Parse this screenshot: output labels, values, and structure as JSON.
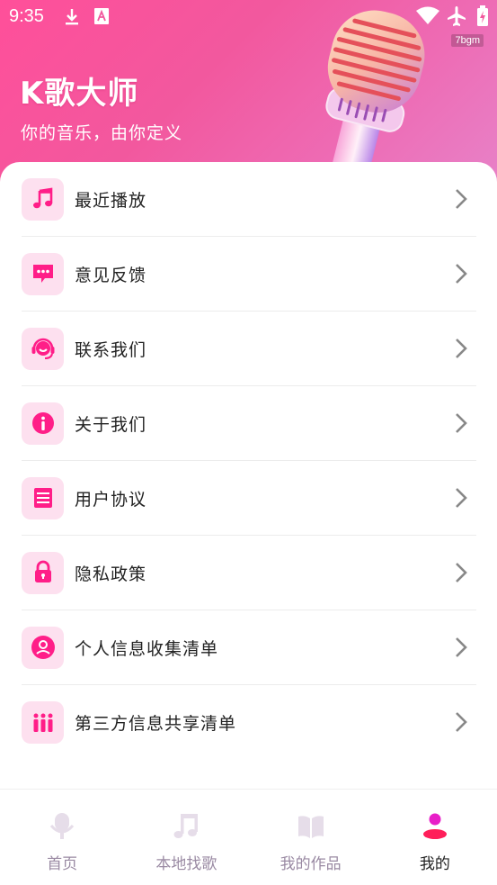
{
  "status_bar": {
    "time": "9:35",
    "watermark": "7bgm"
  },
  "header": {
    "app_title": "K歌大师",
    "subtitle": "你的音乐，由你定义"
  },
  "menu": {
    "items": [
      {
        "label": "最近播放",
        "icon": "music-note-icon"
      },
      {
        "label": "意见反馈",
        "icon": "chat-bubble-icon"
      },
      {
        "label": "联系我们",
        "icon": "headset-icon"
      },
      {
        "label": "关于我们",
        "icon": "info-icon"
      },
      {
        "label": "用户协议",
        "icon": "document-icon"
      },
      {
        "label": "隐私政策",
        "icon": "lock-icon"
      },
      {
        "label": "个人信息收集清单",
        "icon": "user-circle-icon"
      },
      {
        "label": "第三方信息共享清单",
        "icon": "bars-icon"
      }
    ]
  },
  "tabbar": {
    "tabs": [
      {
        "label": "首页",
        "icon": "microphone-icon",
        "active": false
      },
      {
        "label": "本地找歌",
        "icon": "music-note-icon",
        "active": false
      },
      {
        "label": "我的作品",
        "icon": "book-icon",
        "active": false
      },
      {
        "label": "我的",
        "icon": "user-icon",
        "active": true
      }
    ]
  },
  "colors": {
    "accent": "#ff1e88",
    "icon_bg": "#fde0ef",
    "header_gradient_start": "#ff4f9a",
    "header_gradient_end": "#e783c9",
    "tab_inactive": "#9a8aa3"
  }
}
